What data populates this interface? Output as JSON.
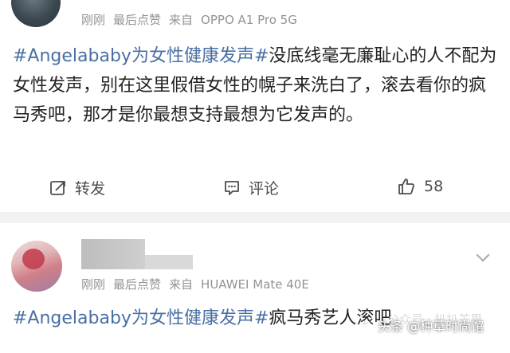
{
  "post1": {
    "meta": [
      "刚刚",
      "最后点赞",
      "来自",
      "OPPO A1 Pro 5G"
    ],
    "hashtag": "#Angelababy为女性健康发声#",
    "text": "没底线毫无廉耻心的人不配为女性发声，别在这里假借女性的幌子来洗白了，滚去看你的疯马秀吧，那才是你最想支持最想为它发声的。",
    "actions": {
      "repost": "转发",
      "comment": "评论",
      "like": "58"
    }
  },
  "post2": {
    "meta": [
      "刚刚",
      "最后点赞",
      "来自",
      "HUAWEI Mate 40E"
    ],
    "hashtag": "#Angelababy为女性健康发声#",
    "text": "疯马秀艺人滚吧"
  },
  "watermark": {
    "label": "头条 @种草时尚馆",
    "ghost": "公众号 · 扒扒芒果"
  },
  "colors": {
    "tag": "#4a6fa5",
    "meta": "#939393",
    "separator": "#f2f2f2"
  }
}
